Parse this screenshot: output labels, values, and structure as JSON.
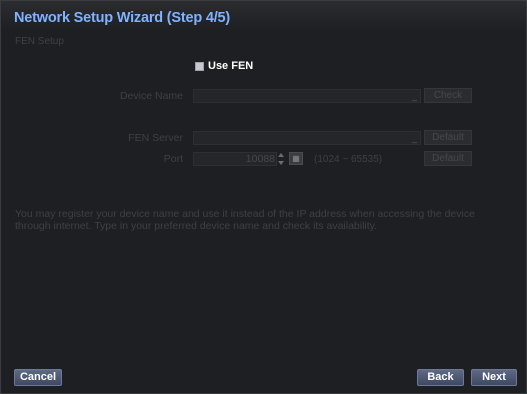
{
  "dialog": {
    "title": "Network Setup Wizard (Step 4/5)",
    "section": "FEN Setup"
  },
  "fen": {
    "use_label": "Use FEN",
    "use_checked": true,
    "device_name_label": "Device Name",
    "device_name_value": "",
    "check_label": "Check",
    "server_label": "FEN Server",
    "server_value": "",
    "server_default_label": "Default",
    "port_label": "Port",
    "port_value": "10088",
    "port_range": "(1024 ~ 65535)",
    "port_default_label": "Default",
    "keyboard_icon": "keyboard-icon"
  },
  "description": "You may register your device name and use it instead of the IP address when accessing the device through internet. Type in your preferred device name and check its availability.",
  "footer": {
    "cancel_label": "Cancel",
    "back_label": "Back",
    "next_label": "Next"
  }
}
